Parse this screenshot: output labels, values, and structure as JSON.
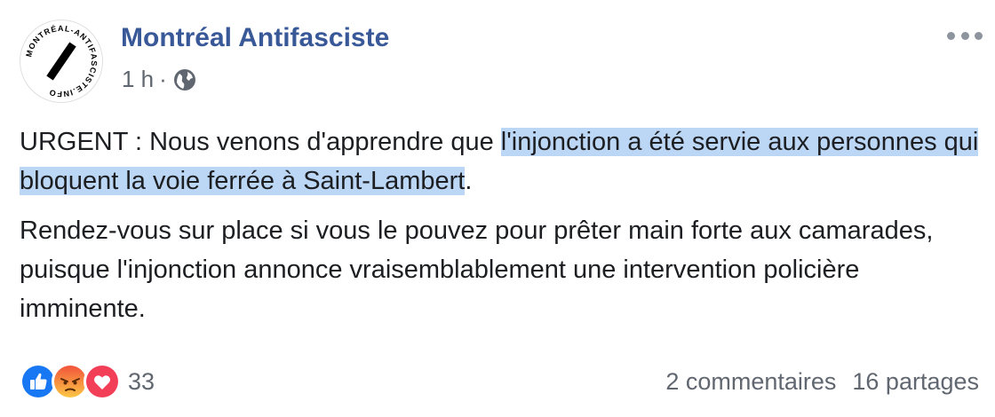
{
  "post": {
    "page_name": "Montréal Antifasciste",
    "time": "1 h",
    "separator": "·",
    "avatar_text": "MONTRÉAL-ANTIFASCISTE.INFO",
    "text_1_plain": "URGENT : Nous venons d'apprendre que ",
    "text_1_highlight": "l'injonction a été servie aux personnes qui bloquent la voie ferrée à Saint-Lambert",
    "text_1_end": ".",
    "text_2": "Rendez-vous sur place si vous le pouvez pour prêter main forte aux camarades, puisque l'injonction annonce vraisemblablement une intervention policière imminente."
  },
  "footer": {
    "reaction_count": "33",
    "comments": "2 commentaires",
    "shares": "16 partages"
  },
  "icons": {
    "audience": "globe-icon",
    "menu": "more-horizontal-icon",
    "reactions": [
      "like-icon",
      "angry-icon",
      "love-icon"
    ]
  },
  "colors": {
    "link": "#385898",
    "highlight": "#bcd6f5",
    "like": "#1877f2",
    "angry": "#f7714c",
    "love": "#f33e58"
  }
}
